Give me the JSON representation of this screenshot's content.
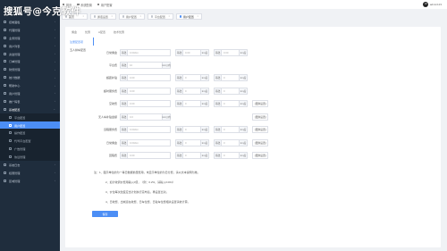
{
  "watermark": "搜狐号@今克软件",
  "sidebar": {
    "items": [
      {
        "label": "控制面板"
      },
      {
        "label": "代理管理"
      },
      {
        "label": "业务管理"
      },
      {
        "label": "用户列表"
      },
      {
        "label": "资金管理"
      },
      {
        "label": "订单管理"
      },
      {
        "label": "财务管理"
      },
      {
        "label": "统计数据"
      },
      {
        "label": "帮助中心"
      },
      {
        "label": "用户管理"
      },
      {
        "label": "推广码表"
      },
      {
        "label": "系统配置"
      }
    ],
    "sub_items": [
      {
        "label": "平台配置"
      },
      {
        "label": "用户配置"
      },
      {
        "label": "操作配置"
      },
      {
        "label": "代驾平台配置"
      },
      {
        "label": "广告管理"
      },
      {
        "label": "协议管理"
      }
    ],
    "bottom_items": [
      {
        "label": "系统日志"
      },
      {
        "label": "权限管理"
      },
      {
        "label": "区域管理"
      }
    ]
  },
  "topbar": {
    "crumbs": [
      "首页",
      "系统配置",
      "用户配置"
    ],
    "avatar_text": "JO",
    "username": "admin123"
  },
  "tabs": [
    {
      "label": "首页"
    },
    {
      "label": "通话设置"
    },
    {
      "label": "用户配置"
    },
    {
      "label": "平台配置"
    },
    {
      "label": "用户配置"
    }
  ],
  "card": {
    "subtabs": [
      "佣金",
      "优惠",
      "A配置",
      "技术优惠"
    ],
    "leftnav": [
      "注册配置项",
      "五人拼车配置"
    ],
    "rows": [
      {
        "label": "日常佣金",
        "a_pre": "基础",
        "a_val": "0.00/km",
        "b_pre": "基础",
        "b_val": "0.00",
        "b_suf": "km后",
        "c_pre": "基础",
        "c_val": "0.00",
        "c_suf": "km后",
        "btn": ""
      },
      {
        "label": "平台费",
        "a_pre": "基础",
        "a_val": "10",
        "a_suf": "km以内",
        "btn": ""
      },
      {
        "label": "超距补贴",
        "a_pre": "基础",
        "a_val": "0.00",
        "b_pre": "基础",
        "b_val": "0",
        "b_suf": "km后",
        "c_pre": "基础",
        "c_val": "0",
        "c_suf": "km后",
        "btn": ""
      },
      {
        "label": "超时服务费",
        "a_pre": "基础",
        "a_val": "0.00",
        "b_pre": "基础",
        "b_val": "0",
        "b_suf": "km后",
        "c_pre": "基础",
        "c_val": "0",
        "c_suf": "km后",
        "btn": ""
      },
      {
        "label": "空驶费",
        "a_pre": "基础",
        "a_val": "0.00",
        "b_pre": "基础",
        "b_val": "0",
        "b_suf": "km后",
        "c_pre": "基础",
        "c_val": "0",
        "c_suf": "km后",
        "btn": "[更换设置]"
      },
      {
        "label": "无人车补贴金额",
        "a_pre": "基础",
        "a_val": "0.0",
        "a_suf": "km以内",
        "btn": "[更换设置]"
      },
      {
        "label": "远程服务费",
        "a_pre": "基础",
        "a_val": "0.00/km",
        "b_pre": "基础",
        "b_val": "0",
        "b_suf": "km后",
        "c_pre": "基础",
        "c_val": "0",
        "c_suf": "km后",
        "btn": "[更换设置]"
      },
      {
        "label": "日常佣金",
        "a_pre": "基础",
        "a_val": "0.00/km",
        "b_pre": "基础",
        "b_val": "0",
        "b_suf": "km后",
        "c_pre": "基础",
        "c_val": "0",
        "c_suf": "km后",
        "btn": "[更换设置]"
      },
      {
        "label": "回程费",
        "a_pre": "基础",
        "a_val": "0.00",
        "b_pre": "基础",
        "b_val": "0",
        "b_suf": "km后",
        "c_pre": "基础",
        "c_val": "0",
        "c_suf": "km后",
        "btn": "[更换设置]"
      }
    ],
    "notes": [
      "注：1、图示单位的为一等日数据前里费用，未显示单位的为日分费，请以文本说明为准。",
      "2、如计收调价费用输入0值，（例：0.2%，请输入0.004）",
      "3、价位每次改变应当计划执行完毕后，再设置比对。",
      "4、日收费、出城远在收费、日车位费、日驻车位费相关设置请依计算。"
    ],
    "save_label": "保存"
  }
}
